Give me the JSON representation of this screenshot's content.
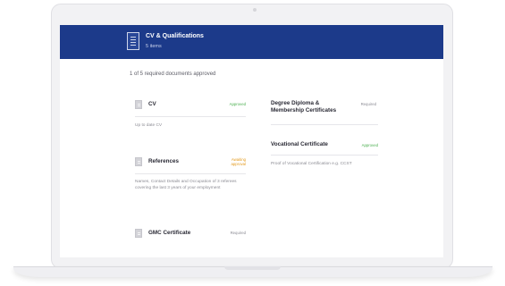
{
  "header": {
    "title": "CV & Qualifications",
    "subtitle": "5 items"
  },
  "status_text": "1 of 5 required documents approved",
  "documents": {
    "cv": {
      "title": "CV",
      "status": "Approved",
      "description": "Up to date CV"
    },
    "references": {
      "title": "References",
      "status": "Awaiting approval",
      "description": "Names, Contact Details and Occupation of 3 referees covering the last 3 years of your employment"
    },
    "gmc": {
      "title": "GMC Certificate",
      "status": "Required"
    },
    "degree": {
      "title": "Degree Diploma & Membership Certificates",
      "status": "Required"
    },
    "vocational": {
      "title": "Vocational Certificate",
      "status": "Approved",
      "description": "Proof of Vocational Certification e.g. CCST"
    }
  },
  "colors": {
    "header_bg": "#1c3a8a",
    "approved": "#4caf50",
    "awaiting": "#e39b20",
    "required": "#8a8a93"
  }
}
